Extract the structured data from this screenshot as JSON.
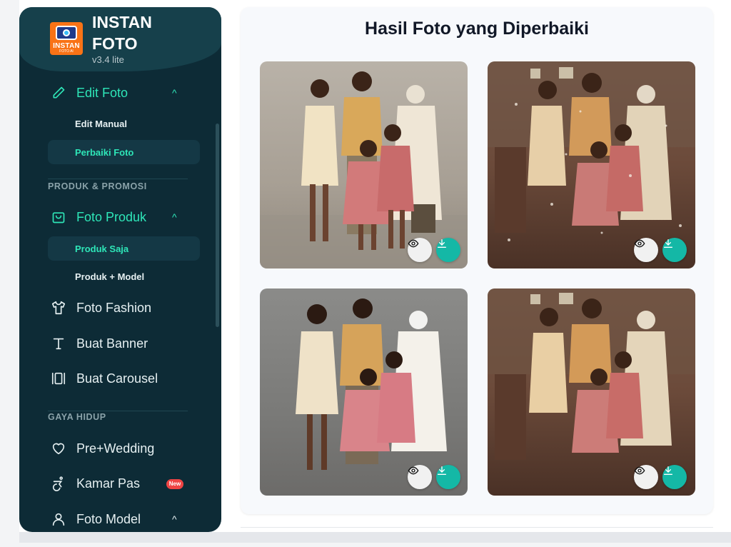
{
  "brand": {
    "logo_line1": "INSTAN",
    "logo_line2": "FOTO AI",
    "name_line1": "INSTAN",
    "name_line2": "FOTO",
    "version": "v3.4 lite"
  },
  "sidebar": {
    "edit_foto": {
      "label": "Edit Foto",
      "icon": "pencil-icon",
      "chevron": "^"
    },
    "edit_manual": "Edit Manual",
    "perbaiki_foto": "Perbaiki Foto",
    "section_produk": "PRODUK & PROMOSI",
    "foto_produk": {
      "label": "Foto Produk",
      "icon": "shopping-bag-icon",
      "chevron": "^"
    },
    "produk_saja": "Produk Saja",
    "produk_model": "Produk + Model",
    "foto_fashion": {
      "label": "Foto Fashion",
      "icon": "shirt-icon"
    },
    "buat_banner": {
      "label": "Buat Banner",
      "icon": "text-icon"
    },
    "buat_carousel": {
      "label": "Buat Carousel",
      "icon": "carousel-icon"
    },
    "section_gaya": "GAYA HIDUP",
    "pre_wedding": {
      "label": "Pre+Wedding",
      "icon": "heart-icon"
    },
    "kamar_pas": {
      "label": "Kamar Pas",
      "icon": "accessibility-icon",
      "badge": "New"
    },
    "foto_model": {
      "label": "Foto Model",
      "icon": "user-icon",
      "chevron": "^"
    }
  },
  "main": {
    "title": "Hasil Foto yang Diperbaiki",
    "photos": [
      {
        "kind": "restored",
        "view_icon": "eye-icon",
        "download_icon": "download-icon"
      },
      {
        "kind": "original",
        "view_icon": "eye-icon",
        "download_icon": "download-icon"
      },
      {
        "kind": "restored",
        "view_icon": "eye-icon",
        "download_icon": "download-icon"
      },
      {
        "kind": "original",
        "view_icon": "eye-icon",
        "download_icon": "download-icon"
      }
    ]
  },
  "colors": {
    "sidebar_bg": "#0d2b36",
    "accent": "#2ee6b8",
    "download_btn": "#14b8a6",
    "badge_new": "#ef4444"
  }
}
